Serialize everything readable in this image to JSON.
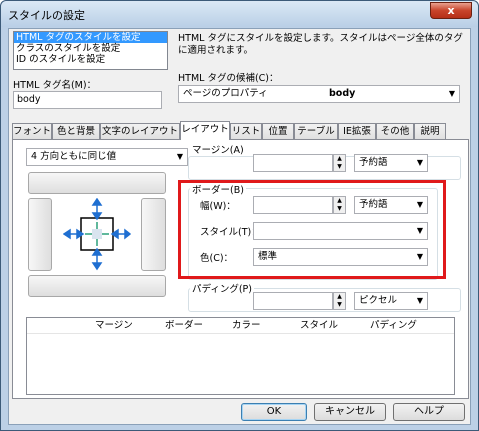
{
  "window": {
    "title": "スタイルの設定",
    "close_glyph": "x"
  },
  "scope_list": {
    "items": [
      "HTML タグのスタイルを設定",
      "クラスのスタイルを設定",
      "ID のスタイルを設定"
    ],
    "selected_index": 0
  },
  "description": "HTML タグにスタイルを設定します。スタイルはページ全体のタグに適用されます。",
  "tag_name": {
    "label": "HTML タグ名(M)：",
    "value": "body"
  },
  "tag_candidates": {
    "label": "HTML タグの候補(C)：",
    "value_prefix": "ページのプロパティ",
    "value_tag": "body"
  },
  "tabs": [
    "フォント",
    "色と背景",
    "文字のレイアウト",
    "レイアウト",
    "リスト",
    "位置",
    "テーブル",
    "IE拡張",
    "その他",
    "説明"
  ],
  "active_tab": "レイアウト",
  "layout": {
    "direction_select": "4 方向ともに同じ値",
    "margin": {
      "label": "マージン(A)",
      "value": "",
      "unit": "予約語"
    },
    "border": {
      "label": "ボーダー(B)",
      "width_label": "幅(W)：",
      "width_value": "",
      "width_unit": "予約語",
      "style_label": "スタイル(T)：",
      "style_value": "",
      "color_label": "色(C)：",
      "color_value": "標準"
    },
    "padding": {
      "label": "パディング(P)",
      "value": "",
      "unit": "ピクセル"
    }
  },
  "summary_table": {
    "columns": [
      "マージン",
      "ボーダー",
      "カラー",
      "スタイル",
      "パディング"
    ]
  },
  "buttons": {
    "ok": "OK",
    "cancel": "キャンセル",
    "help": "ヘルプ"
  },
  "colors": {
    "highlight_box": "#e0191b",
    "selection": "#3399ff",
    "arrow_blue": "#1f6fd1",
    "arrow_green": "#2aa07a"
  }
}
